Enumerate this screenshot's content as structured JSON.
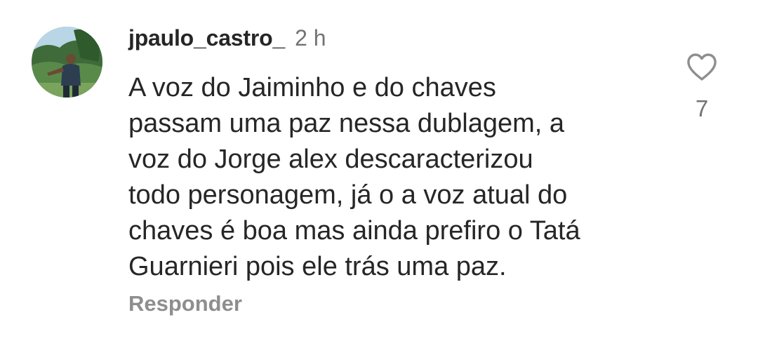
{
  "comment": {
    "username": "jpaulo_castro_",
    "time": "2 h",
    "text_lines": [
      "A voz do Jaiminho e do chaves",
      "passam uma paz nessa dublagem, a",
      "voz do Jorge alex descaracterizou",
      "todo personagem, já o a voz atual do",
      "chaves é boa mas ainda prefiro o Tatá",
      "Guarnieri pois ele trás uma paz."
    ],
    "reply_label": "Responder",
    "like_count": "7",
    "like_icon": "heart-outline-icon"
  },
  "colors": {
    "text": "#262626",
    "secondary": "#737373",
    "reply": "#8e8e8e",
    "background": "#ffffff"
  }
}
